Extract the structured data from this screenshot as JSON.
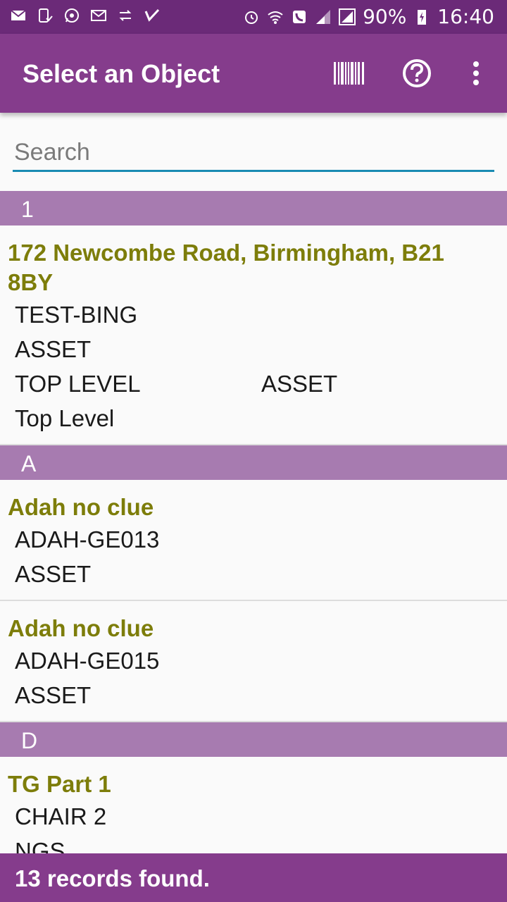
{
  "status_bar": {
    "left_icons": [
      "mail-icon",
      "phone-check-icon",
      "whatsapp-icon",
      "gmail-icon",
      "transfer-icon",
      "task-icon"
    ],
    "right_icons": [
      "alarm-icon",
      "wifi-call-icon",
      "phone-icon",
      "signal-icon",
      "signal-icon"
    ],
    "battery": "90%",
    "time": "16:40"
  },
  "app_bar": {
    "title": "Select an Object",
    "actions": [
      "barcode-icon",
      "help-icon",
      "more-vert-icon"
    ]
  },
  "search": {
    "placeholder": "Search",
    "value": ""
  },
  "list": [
    {
      "header": "1",
      "items": [
        {
          "title": "172 Newcombe Road, Birmingham, B21 8BY",
          "lines": [
            [
              "TEST-BING"
            ],
            [
              "ASSET"
            ],
            [
              "TOP LEVEL",
              "ASSET"
            ],
            [
              "Top Level"
            ]
          ]
        }
      ]
    },
    {
      "header": "A",
      "items": [
        {
          "title": "Adah no clue",
          "lines": [
            [
              "ADAH-GE013"
            ],
            [
              "ASSET"
            ]
          ]
        },
        {
          "title": "Adah no clue",
          "lines": [
            [
              "ADAH-GE015"
            ],
            [
              "ASSET"
            ]
          ]
        }
      ]
    },
    {
      "header": "D",
      "items": [
        {
          "title": "TG Part 1",
          "lines": [
            [
              "CHAIR 2"
            ],
            [
              "NGS"
            ]
          ]
        }
      ]
    }
  ],
  "footer": {
    "text": "13 records found."
  },
  "colors": {
    "status_bar": "#6b2a78",
    "app_bar": "#853c8c",
    "section_header": "#a77bb0",
    "title_text": "#7d7d0a",
    "search_underline": "#1a8bb3"
  }
}
